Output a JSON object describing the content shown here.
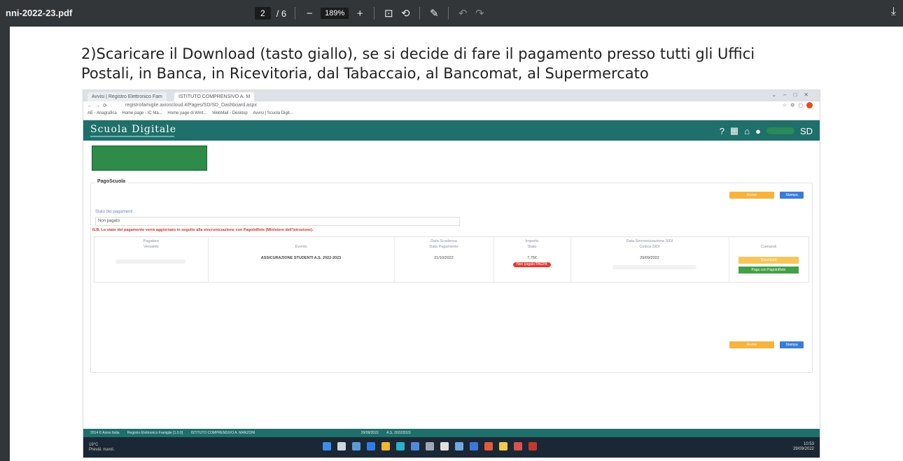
{
  "pdf_viewer": {
    "filename": "nni-2022-23.pdf",
    "page_current": "2",
    "page_total": "/ 6",
    "zoom": "189%",
    "icons": [
      "minus-icon",
      "plus-icon",
      "fit-page-icon",
      "rotate-icon",
      "annotate-icon",
      "undo-icon",
      "redo-icon",
      "download-icon"
    ]
  },
  "document": {
    "instruction": "2)Scaricare il Download (tasto giallo), se si decide di fare il pagamento presso tutti gli Uffici Postali, in Banca, in Ricevitoria, dal Tabaccaio, al Bancomat, al Supermercato"
  },
  "screenshot": {
    "tabs": [
      "Avvisi | Registro Elettronico Fam",
      "ISTITUTO COMPRENSIVO A. M"
    ],
    "url": "registrofamiglie.axioscloud.it/Pages/SD/SD_Dashboard.aspx",
    "bookmarks": [
      "AE - Anagrafica",
      "Home page - IC Ma...",
      "Home page di Wint...",
      "WebMail - Desktop",
      "Avvisi | Scuola Digit..."
    ],
    "app_title": "Scuola Digitale",
    "panel_title": "PagoScuola",
    "status_label": "Stato dei pagamenti",
    "status_value": "Non pagato",
    "note": "N.B. Lo stato del pagamento verrà aggiornato in seguito alla sincronizzazione con PagoInRete (Ministero dell'Istruzione).",
    "table": {
      "headers": {
        "payer": "Pagatore\nVersante",
        "event": "Evento",
        "dates": "Data Scadenza\nData Pagamento",
        "amount": "Importo\nStato",
        "sync": "Data Sincronizzazione SIDI\nCodice SIDI",
        "commands": "Comandi"
      },
      "row": {
        "event": "ASSICURAZIONE STUDENTI A.S. 2022-2023",
        "due_date": "21/10/2022",
        "amount": "7,75€",
        "status": "Non pagato PAGPA",
        "sync_date": "29/09/2022"
      }
    },
    "buttons": {
      "download": "Avviso",
      "print": "Stampa",
      "cmd_download": "Download",
      "cmd_pay": "Paga con PagoInRete"
    },
    "footer": [
      "2014 © Axios Italia",
      "Registro Elettronico Famiglie [1.0.0]",
      "ISTITUTO COMPRENSIVO A. MANZONI",
      "29/09/2022",
      "A.S. 2022/2023"
    ],
    "taskbar": {
      "weather": "19°C",
      "weather_desc": "Prevál. nuvol.",
      "time": "10:53",
      "date": "29/09/2022"
    }
  }
}
